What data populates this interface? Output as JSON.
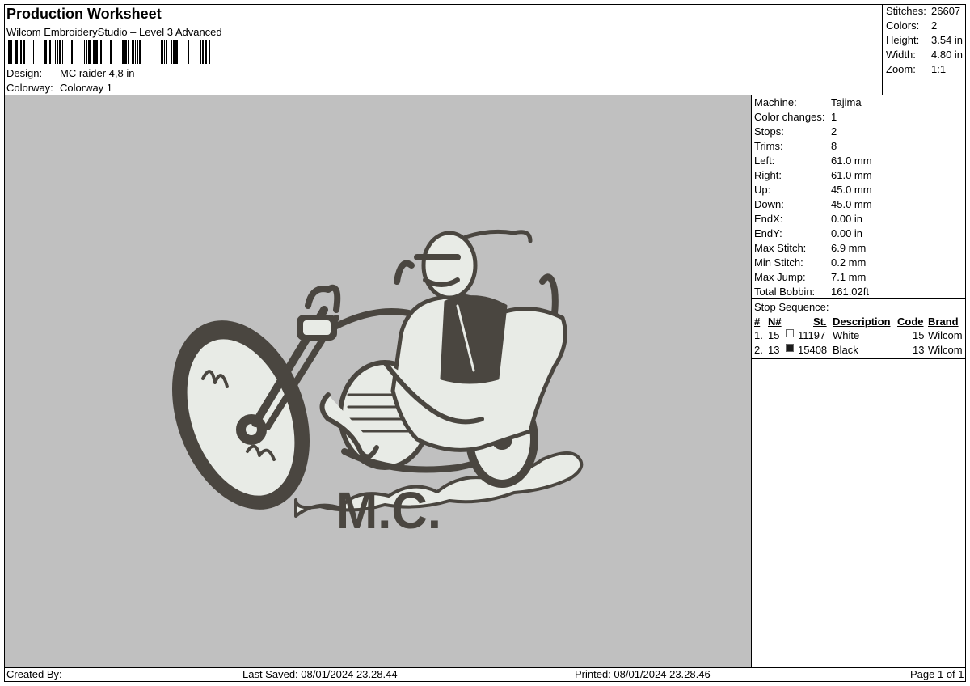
{
  "header": {
    "title": "Production Worksheet",
    "subtitle": "Wilcom EmbroideryStudio – Level 3 Advanced",
    "design_label": "Design:",
    "design_value": "MC raider 4,8 in",
    "colorway_label": "Colorway:",
    "colorway_value": "Colorway 1"
  },
  "summary": {
    "stitches_label": "Stitches:",
    "stitches": "26607",
    "colors_label": "Colors:",
    "colors": "2",
    "height_label": "Height:",
    "height": "3.54 in",
    "width_label": "Width:",
    "width": "4.80 in",
    "zoom_label": "Zoom:",
    "zoom": "1:1"
  },
  "design_text": "M.C.",
  "machine": [
    {
      "label": "Machine:",
      "value": "Tajima"
    },
    {
      "label": "Color changes:",
      "value": "1"
    },
    {
      "label": "Stops:",
      "value": "2"
    },
    {
      "label": "Trims:",
      "value": "8"
    },
    {
      "label": "Left:",
      "value": "61.0 mm"
    },
    {
      "label": "Right:",
      "value": "61.0 mm"
    },
    {
      "label": "Up:",
      "value": "45.0 mm"
    },
    {
      "label": "Down:",
      "value": "45.0 mm"
    },
    {
      "label": "EndX:",
      "value": "0.00 in"
    },
    {
      "label": "EndY:",
      "value": "0.00 in"
    },
    {
      "label": "Max Stitch:",
      "value": "6.9 mm"
    },
    {
      "label": "Min Stitch:",
      "value": "0.2 mm"
    },
    {
      "label": "Max Jump:",
      "value": "7.1 mm"
    },
    {
      "label": "Total Bobbin:",
      "value": "161.02ft"
    }
  ],
  "stop_sequence": {
    "title": "Stop Sequence:",
    "headers": {
      "num": "#",
      "n": "N#",
      "st": "St.",
      "desc": "Description",
      "code": "Code",
      "brand": "Brand"
    },
    "rows": [
      {
        "num": "1.",
        "n": "15",
        "swatch": "#ffffff",
        "st": "11197",
        "desc": "White",
        "code": "15",
        "brand": "Wilcom"
      },
      {
        "num": "2.",
        "n": "13",
        "swatch": "#1a1a1a",
        "st": "15408",
        "desc": "Black",
        "code": "13",
        "brand": "Wilcom"
      }
    ]
  },
  "footer": {
    "created": "Created By:",
    "saved": "Last Saved: 08/01/2024 23.28.44",
    "printed": "Printed: 08/01/2024 23.28.46",
    "page": "Page 1 of 1"
  },
  "colors": {
    "canvas": "#c0c0c0",
    "thread_dark": "#4a4640",
    "thread_light": "#e8ebe6"
  }
}
